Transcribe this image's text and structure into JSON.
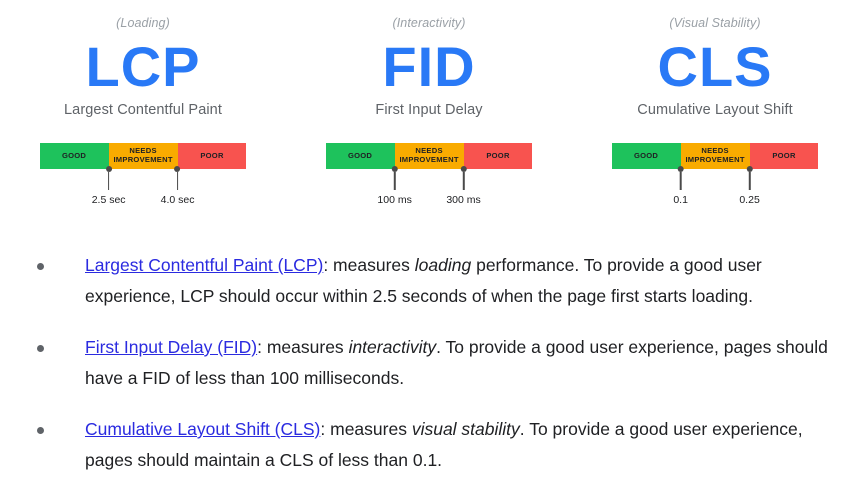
{
  "page": {
    "background": "#ffffff",
    "accent_blue": "#2979f6",
    "link_color": "#2b2be0"
  },
  "metrics": [
    {
      "category": "(Loading)",
      "acronym": "LCP",
      "name": "Largest Contentful Paint",
      "segments": [
        {
          "label": "GOOD",
          "color": "#1ec25c"
        },
        {
          "label": "NEEDS IMPROVEMENT",
          "color": "#f9ab00"
        },
        {
          "label": "POOR",
          "color": "#f8534f"
        }
      ],
      "thresholds": [
        "2.5 sec",
        "4.0 sec"
      ]
    },
    {
      "category": "(Interactivity)",
      "acronym": "FID",
      "name": "First Input Delay",
      "segments": [
        {
          "label": "GOOD",
          "color": "#1ec25c"
        },
        {
          "label": "NEEDS IMPROVEMENT",
          "color": "#f9ab00"
        },
        {
          "label": "POOR",
          "color": "#f8534f"
        }
      ],
      "thresholds": [
        "100 ms",
        "300 ms"
      ]
    },
    {
      "category": "(Visual Stability)",
      "acronym": "CLS",
      "name": "Cumulative Layout Shift",
      "segments": [
        {
          "label": "GOOD",
          "color": "#1ec25c"
        },
        {
          "label": "NEEDS IMPROVEMENT",
          "color": "#f9ab00"
        },
        {
          "label": "POOR",
          "color": "#f8534f"
        }
      ],
      "thresholds": [
        "0.1",
        "0.25"
      ]
    }
  ],
  "bullets": [
    {
      "link": "Largest Contentful Paint (LCP)",
      "pre_emphasis": ": measures ",
      "emphasis": "loading",
      "rest": " performance. To provide a good user experience, LCP should occur within 2.5 seconds of when the page first starts loading."
    },
    {
      "link": "First Input Delay (FID)",
      "pre_emphasis": ": measures ",
      "emphasis": "interactivity",
      "rest": ". To provide a good user experience, pages should have a FID of less than 100 milliseconds."
    },
    {
      "link": "Cumulative Layout Shift (CLS)",
      "pre_emphasis": ": measures ",
      "emphasis": "visual stability",
      "rest": ". To provide a good user experience, pages should maintain a CLS of less than 0.1."
    }
  ]
}
